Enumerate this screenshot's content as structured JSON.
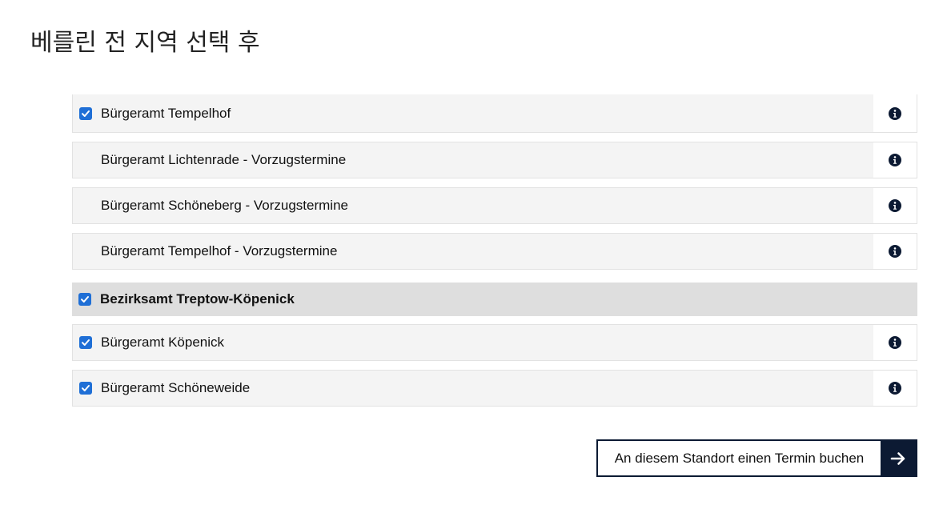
{
  "page": {
    "title": "베를린 전 지역 선택 후"
  },
  "list": {
    "rows_top": [
      {
        "label": "Bürgeramt Tempelhof",
        "checked": true
      },
      {
        "label": "Bürgeramt Lichtenrade - Vorzugstermine",
        "checked": false
      },
      {
        "label": "Bürgeramt Schöneberg - Vorzugstermine",
        "checked": false
      },
      {
        "label": "Bürgeramt Tempelhof - Vorzugstermine",
        "checked": false
      }
    ],
    "group": {
      "label": "Bezirksamt Treptow-Köpenick",
      "checked": true
    },
    "rows_group": [
      {
        "label": "Bürgeramt Köpenick",
        "checked": true
      },
      {
        "label": "Bürgeramt Schöneweide",
        "checked": true
      }
    ]
  },
  "cta": {
    "label": "An diesem Standort einen Termin buchen",
    "icon": "arrow-right-icon"
  },
  "colors": {
    "checkbox": "#1f6fd6",
    "navy": "#0c1a33",
    "row_bg": "#f4f4f4",
    "group_bg": "#dedede"
  },
  "icons": {
    "info": "info-icon",
    "check": "checkmark-icon"
  }
}
